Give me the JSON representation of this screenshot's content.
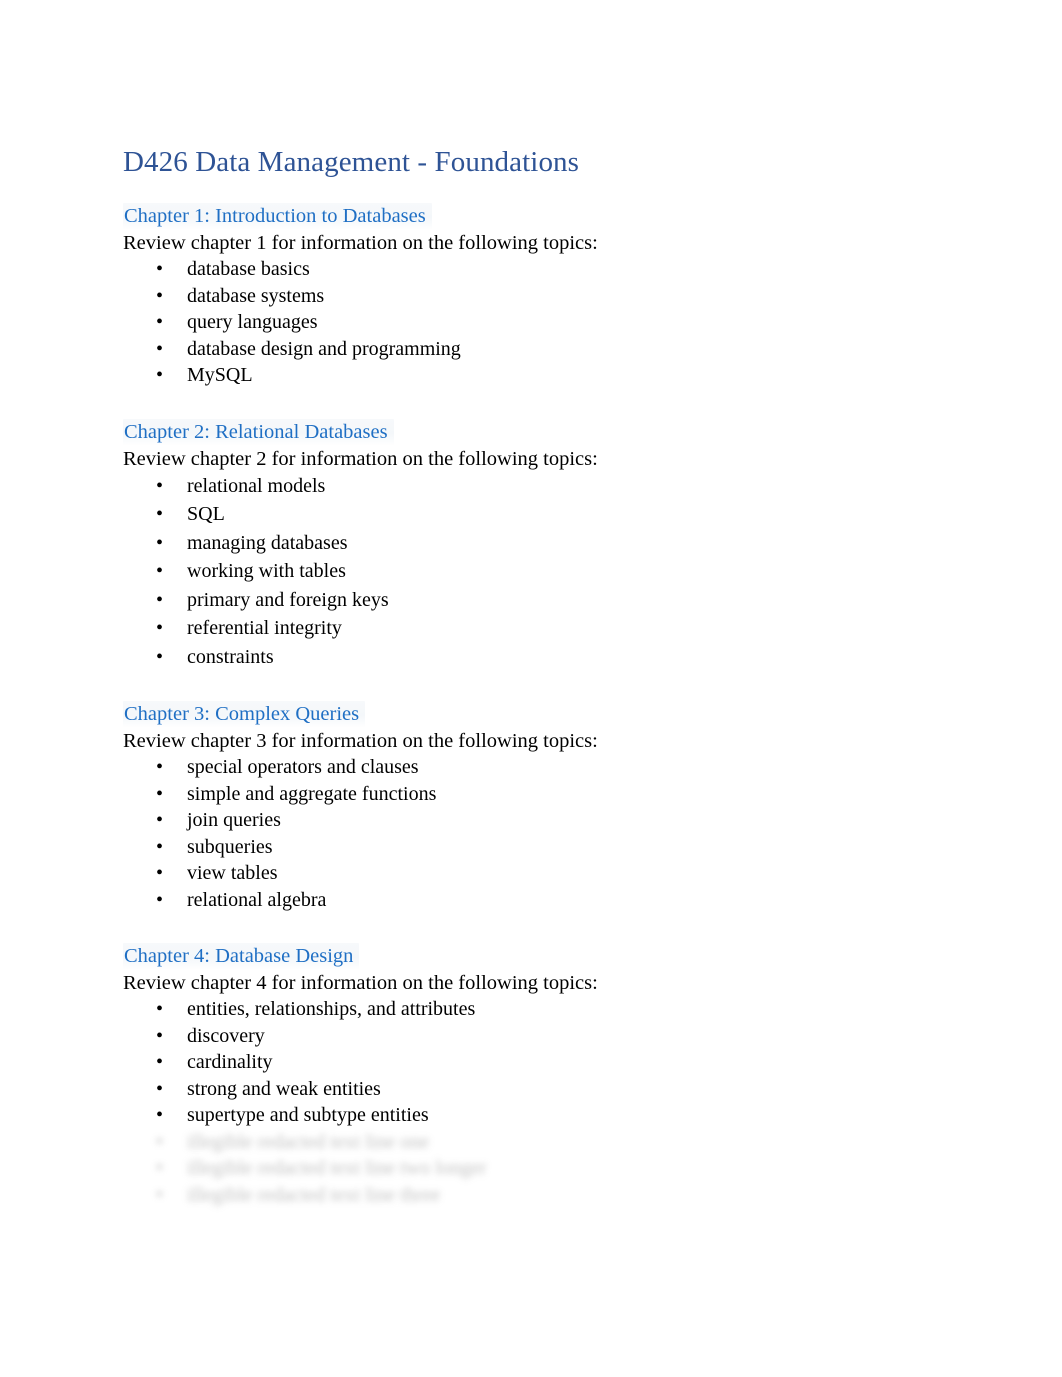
{
  "document": {
    "title": "D426 Data Management - Foundations",
    "heading_color": "#1F6FC4",
    "title_color": "#2E5395",
    "body_color": "#000000",
    "background_color": "#FFFFFF"
  },
  "chapters": [
    {
      "heading": "Chapter 1: Introduction to Databases",
      "intro": "Review chapter 1 for information on the following topics:",
      "topics": [
        {
          "label": "database basics",
          "redacted": false
        },
        {
          "label": "database systems",
          "redacted": false
        },
        {
          "label": "query languages",
          "redacted": false
        },
        {
          "label": "database design and programming",
          "redacted": false
        },
        {
          "label": "MySQL",
          "redacted": false
        }
      ]
    },
    {
      "heading": "Chapter 2: Relational Databases",
      "intro": "Review chapter 2 for information on the following topics:",
      "topics": [
        {
          "label": "relational models",
          "redacted": false
        },
        {
          "label": "SQL",
          "redacted": false
        },
        {
          "label": "managing databases",
          "redacted": false
        },
        {
          "label": "working with tables",
          "redacted": false
        },
        {
          "label": "primary and foreign keys",
          "redacted": false
        },
        {
          "label": "referential integrity",
          "redacted": false
        },
        {
          "label": "constraints",
          "redacted": false
        }
      ]
    },
    {
      "heading": "Chapter 3: Complex Queries",
      "intro": "Review chapter 3 for information on the following topics:",
      "topics": [
        {
          "label": "special operators and clauses",
          "redacted": false
        },
        {
          "label": "simple and aggregate functions",
          "redacted": false
        },
        {
          "label": "join queries",
          "redacted": false
        },
        {
          "label": "subqueries",
          "redacted": false
        },
        {
          "label": "view tables",
          "redacted": false
        },
        {
          "label": "relational algebra",
          "redacted": false
        }
      ]
    },
    {
      "heading": "Chapter 4: Database Design",
      "intro": "Review chapter 4 for information on the following topics:",
      "topics": [
        {
          "label": "entities, relationships, and attributes",
          "redacted": false
        },
        {
          "label": "discovery",
          "redacted": false
        },
        {
          "label": "cardinality",
          "redacted": false
        },
        {
          "label": "strong and weak entities",
          "redacted": false
        },
        {
          "label": "supertype and subtype entities",
          "redacted": false
        },
        {
          "label": "illegible redacted text line one",
          "redacted": true
        },
        {
          "label": "illegible redacted text line two longer",
          "redacted": true
        },
        {
          "label": "illegible redacted text line three",
          "redacted": true
        }
      ]
    }
  ],
  "bullet_glyph": "•"
}
